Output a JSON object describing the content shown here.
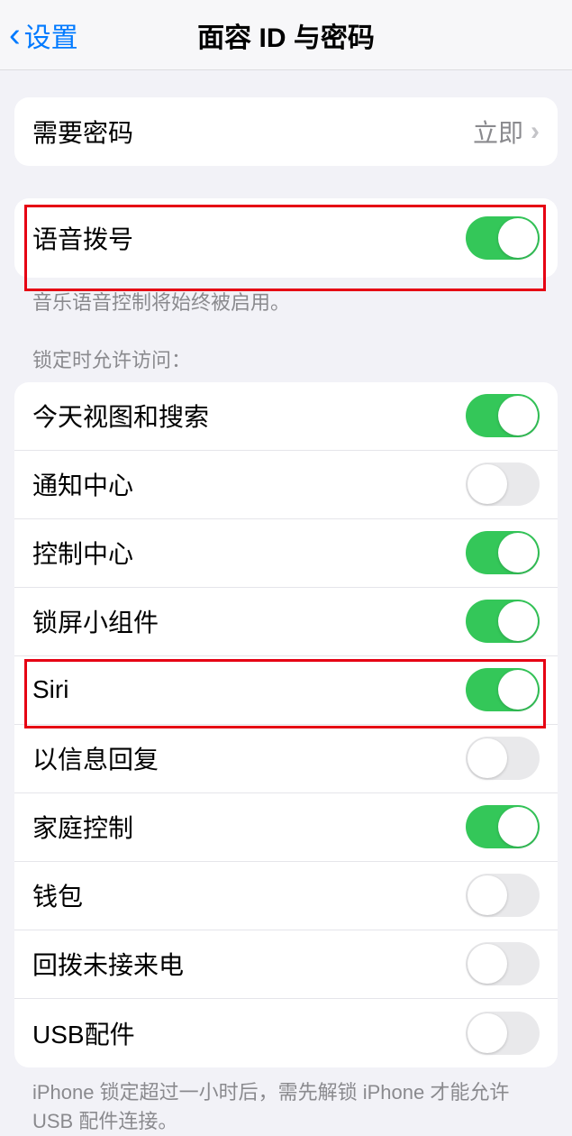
{
  "nav": {
    "back": "设置",
    "title": "面容 ID 与密码"
  },
  "requirePasscode": {
    "label": "需要密码",
    "value": "立即"
  },
  "voiceDial": {
    "label": "语音拨号",
    "on": true,
    "footer": "音乐语音控制将始终被启用。"
  },
  "lockAccess": {
    "header": "锁定时允许访问：",
    "items": [
      {
        "label": "今天视图和搜索",
        "on": true
      },
      {
        "label": "通知中心",
        "on": false
      },
      {
        "label": "控制中心",
        "on": true
      },
      {
        "label": "锁屏小组件",
        "on": true
      },
      {
        "label": "Siri",
        "on": true
      },
      {
        "label": "以信息回复",
        "on": false
      },
      {
        "label": "家庭控制",
        "on": true
      },
      {
        "label": "钱包",
        "on": false
      },
      {
        "label": "回拨未接来电",
        "on": false
      },
      {
        "label": "USB配件",
        "on": false
      }
    ],
    "footer": "iPhone 锁定超过一小时后，需先解锁 iPhone 才能允许 USB 配件连接。"
  }
}
